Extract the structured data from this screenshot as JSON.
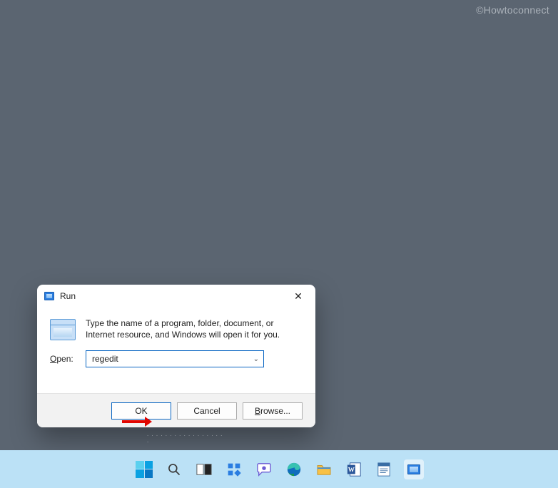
{
  "watermark": "©Howtoconnect",
  "dialog": {
    "title": "Run",
    "close_label": "✕",
    "description": "Type the name of a program, folder, document, or Internet resource, and Windows will open it for you.",
    "open_label_char": "O",
    "open_label_rest": "pen:",
    "input_value": "regedit",
    "buttons": {
      "ok": "OK",
      "cancel": "Cancel",
      "browse_char": "B",
      "browse_rest": "rowse..."
    }
  },
  "taskbar": {
    "items": [
      {
        "name": "start-icon"
      },
      {
        "name": "search-icon"
      },
      {
        "name": "taskview-icon"
      },
      {
        "name": "widgets-icon"
      },
      {
        "name": "chat-icon"
      },
      {
        "name": "edge-icon"
      },
      {
        "name": "file-explorer-icon"
      },
      {
        "name": "word-icon"
      },
      {
        "name": "notepad-icon"
      },
      {
        "name": "run-icon",
        "active": true
      }
    ]
  },
  "ghost_text": ". . . . . . . . . . . . . . . . . ."
}
